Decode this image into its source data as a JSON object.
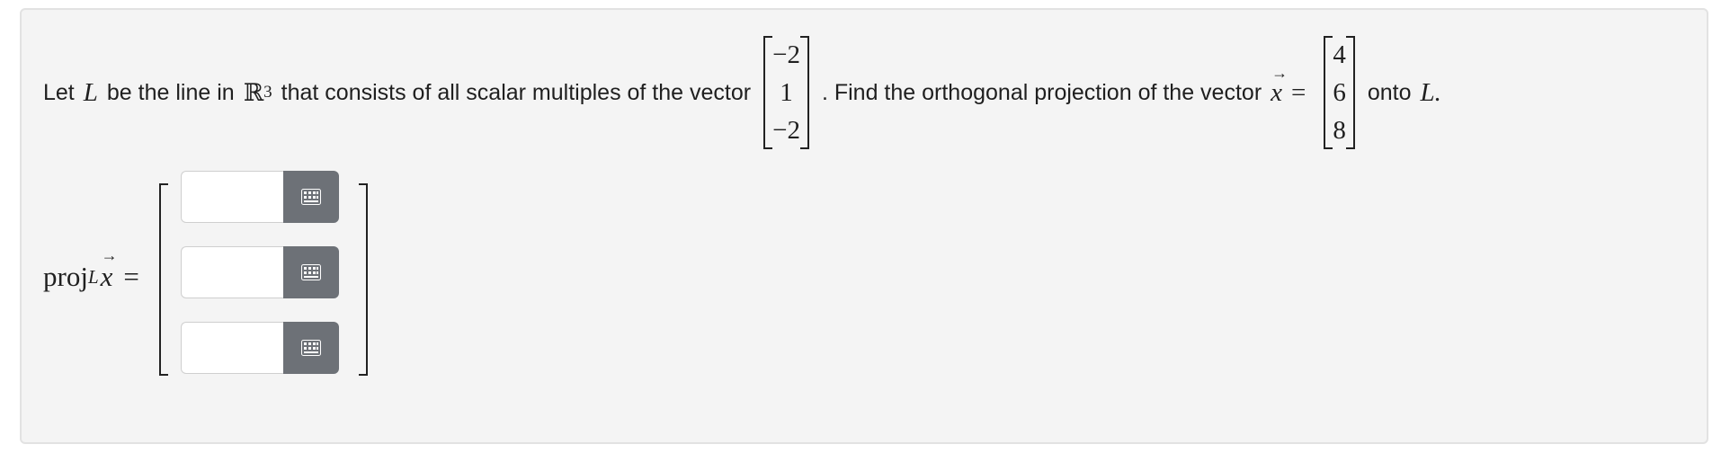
{
  "problem": {
    "text_let": "Let",
    "line_var": "L",
    "text_be_line_in": "be the line in",
    "space_symbol": "ℝ",
    "space_exp": "3",
    "text_consists": "that consists of all scalar multiples of the vector",
    "direction_vector": [
      "−2",
      "1",
      "−2"
    ],
    "text_find": ". Find the orthogonal projection of the vector",
    "x_var": "x",
    "equals": "=",
    "x_vector": [
      "4",
      "6",
      "8"
    ],
    "text_onto": "onto",
    "text_end": "L."
  },
  "answer": {
    "lhs_proj": "proj",
    "lhs_sub": "L",
    "lhs_x": "x",
    "lhs_equals": "=",
    "inputs": [
      {
        "value": "",
        "placeholder": ""
      },
      {
        "value": "",
        "placeholder": ""
      },
      {
        "value": "",
        "placeholder": ""
      }
    ],
    "keypad_icon": "keypad-icon"
  }
}
